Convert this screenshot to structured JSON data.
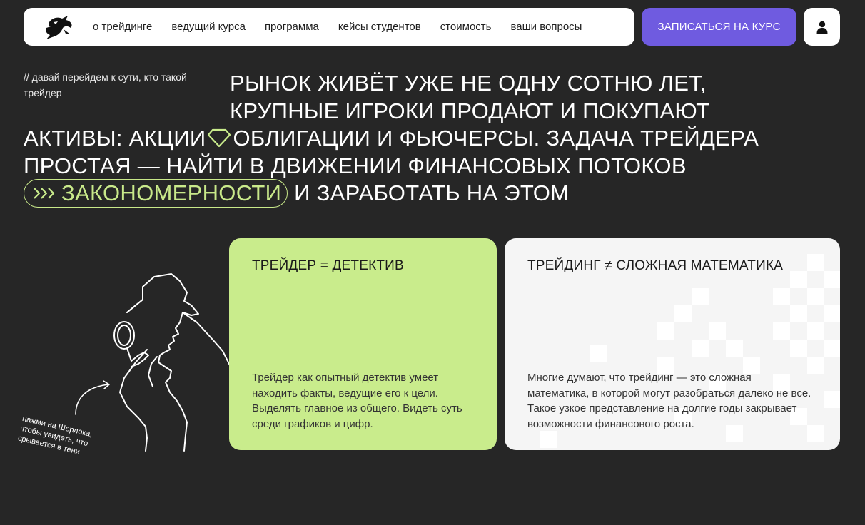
{
  "nav": {
    "links": [
      "о трейдинге",
      "ведущий курса",
      "программа",
      "кейсы студентов",
      "стоимость",
      "ваши вопросы"
    ],
    "cta": "ЗАПИСАТЬСЯ НА КУРС"
  },
  "intro": {
    "note": "// давай перейдем к сути, кто такой трейдер",
    "line1": "РЫНОК ЖИВЁТ УЖЕ НЕ ОДНУ СОТНЮ ЛЕТ,",
    "line2": "КРУПНЫЕ ИГРОКИ ПРОДАЮТ И ПОКУПАЮТ",
    "line3a": "АКТИВЫ: АКЦИИ",
    "line3b": "ОБЛИГАЦИИ И ФЬЮЧЕРСЫ. ЗАДАЧА ТРЕЙДЕРА",
    "line4": "ПРОСТАЯ — НАЙТИ В ДВИЖЕНИИ ФИНАНСОВЫХ ПОТОКОВ",
    "highlight": "ЗАКОНОМЕРНОСТИ",
    "line5": "И ЗАРАБОТАТЬ НА ЭТОМ"
  },
  "sherlock": {
    "caption": "нажми на Шерлока, чтобы увидеть, что срывается в тени"
  },
  "cards": [
    {
      "title": "ТРЕЙДЕР = ДЕТЕКТИВ",
      "text": "Трейдер как опытный детектив умеет находить факты, ведущие его к цели. Выделять главное из общего. Видеть суть среди графиков и цифр."
    },
    {
      "title": "ТРЕЙДИНГ ≠ СЛОЖНАЯ МАТЕМАТИКА",
      "text": "Многие думают, что трейдинг — это сложная математика, в которой могут разобраться далеко не все. Такое узкое представление на долгие годы закрывает возможности финансового роста."
    }
  ],
  "colors": {
    "background": "#262626",
    "accent_purple": "#6f5be0",
    "accent_green": "#c9ec8c",
    "card_white": "#f5f5f5"
  },
  "icons": {
    "logo": "bird-logo-icon",
    "profile": "user-icon",
    "diamond": "diamond-icon",
    "arrows": "triple-chevron-icon"
  }
}
